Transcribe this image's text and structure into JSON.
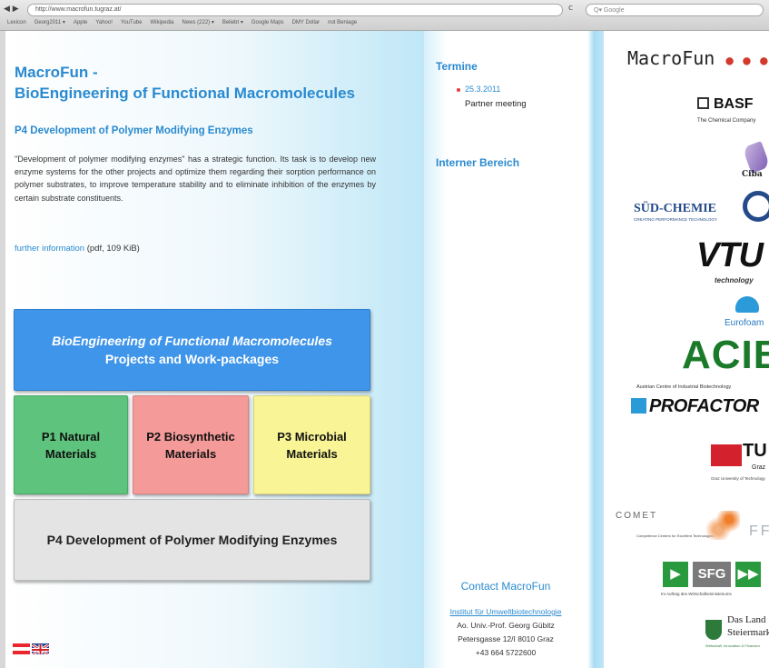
{
  "browser": {
    "back_forward": "◀ ▶",
    "url": "http://www.macrofun.tugraz.at/",
    "reload": "c",
    "search_placeholder": "Google",
    "bookmarks": [
      "Lexicon",
      "Georg2011 ▾",
      "Apple",
      "Yahoo!",
      "YouTube",
      "Wikipedia",
      "News (222) ▾",
      "Beliebt ▾",
      "Google Maps",
      "DMY Dollar",
      "not Beniage"
    ]
  },
  "main": {
    "title_line1": "MacroFun -",
    "title_line2": "BioEngineering of Functional Macromolecules",
    "subtitle": "P4 Development of Polymer Modifying Enzymes",
    "description": "\"Development of polymer modifying enzymes\" has a strategic function. Its task is to develop new enzyme systems for the other projects and optimize them regarding their sorption performance on polymer substrates, to improve temperature stability and to eliminate inhibition of the enzymes by certain substrate constituents.",
    "further_link": "further information",
    "further_suffix": "(pdf, 109 KiB)"
  },
  "diagram": {
    "top_line1": "BioEngineering of Functional Macromolecules",
    "top_line2": "Projects and Work-packages",
    "p1": "P1 Natural Materials",
    "p2": "P2 Biosynthetic Materials",
    "p3": "P3 Microbial Materials",
    "p4": "P4 Development of Polymer Modifying Enzymes"
  },
  "sidebar": {
    "termine_heading": "Termine",
    "event_date": "25.3.2011",
    "event_text": "Partner meeting",
    "intern_heading": "Interner Bereich",
    "contact_heading": "Contact MacroFun",
    "contact_institute": "Institut für Umweltbiotechnologie",
    "contact_name": "Ao. Univ.-Prof. Georg Gübitz",
    "contact_address": "Petersgasse 12/I 8010 Graz",
    "contact_phone": "+43 664 5722600"
  },
  "logos": {
    "macrofun": "MacroFun",
    "macrofun_dots": "● ● ●",
    "basf": "BASF",
    "basf_tag": "The Chemical Company",
    "ciba": "Ciba",
    "sud_chemie": "SÜD-CHEMIE",
    "sud_chemie_tag": "CREATING PERFORMANCE TECHNOLOGY",
    "vtu": "VTU",
    "vtu_tag": "technology",
    "eurofoam": "Eurofoam",
    "acib": "ACIB",
    "acib_tag": "Austrian Centre of Industrial Biotechnology",
    "profactor": "PROFACTOR",
    "tu": "TU",
    "tu_graz": "Graz",
    "tu_tag": "Graz University of Technology",
    "comet": "COMET",
    "comet_tag": "Competence Centers for Excellent Technologies",
    "ffg": "FFG",
    "sfg": "SFG",
    "sfg_tag": "Im Auftrag des Wirtschaftsministeriums",
    "steiermark_line1": "Das Land",
    "steiermark_line2": "Steiermark",
    "steiermark_tag": "Wirtschaft, Innovation & Finanzen"
  },
  "colors": {
    "accent_blue": "#2a8ad0",
    "p1_green": "#5ec37c",
    "p2_red": "#f49a99",
    "p3_yellow": "#f9f495",
    "p4_grey": "#e4e4e4"
  }
}
